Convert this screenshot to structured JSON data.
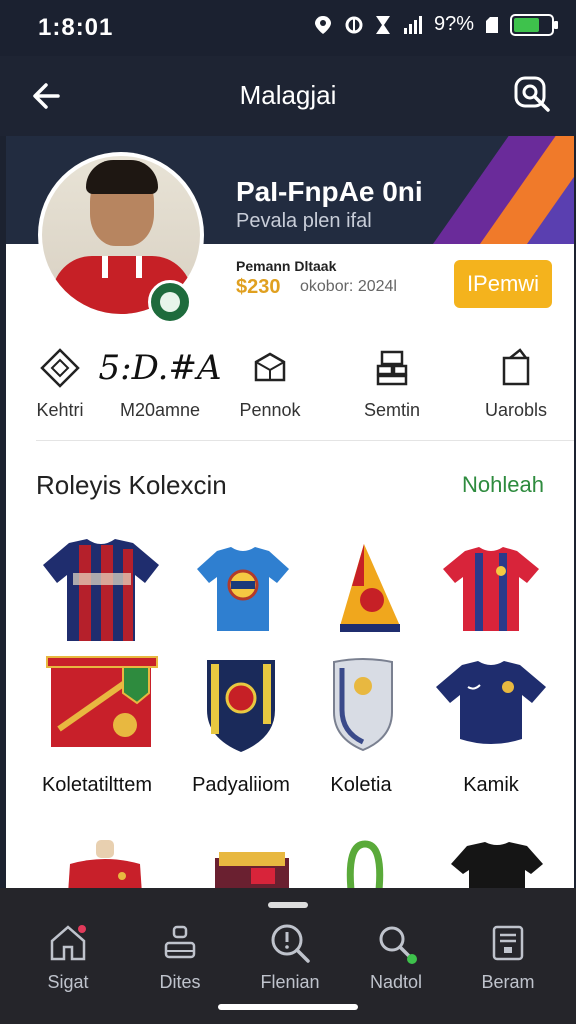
{
  "status_bar": {
    "time": "1:8:01",
    "battery": "9?%"
  },
  "header": {
    "title": "Malagjai",
    "back_icon": "arrow-left-icon",
    "search_icon": "search-icon"
  },
  "profile": {
    "name": "PaI-FnpAe 0ni",
    "subtitle": "Pevala plen ifal",
    "stat_label": "Pemann Dltaak",
    "amount": "$230",
    "date": "okobor: 2024l",
    "follow_label": "IPemwi",
    "accent": "#f4b31d"
  },
  "quick_actions": [
    {
      "label": "Kehtri",
      "icon": "diamond-icon"
    },
    {
      "label": "M20amne",
      "value": "5:D.#A"
    },
    {
      "label": "Pennok",
      "icon": "box-icon"
    },
    {
      "label": "Semtin",
      "icon": "stack-icon"
    },
    {
      "label": "Uarobls",
      "icon": "tag-icon"
    }
  ],
  "collection": {
    "title": "Roleyis Kolexcin",
    "link": "Nohleah",
    "link_color": "#2e8b3e",
    "labels": [
      "Koletatilttem",
      "Padyaliiom",
      "Koletia",
      "Kamik"
    ]
  },
  "bottom_nav": [
    {
      "label": "Sigat",
      "icon": "home-icon"
    },
    {
      "label": "Dites",
      "icon": "user-icon"
    },
    {
      "label": "Flenian",
      "icon": "search-icon"
    },
    {
      "label": "Nadtol",
      "icon": "search-alt-icon"
    },
    {
      "label": "Beram",
      "icon": "document-icon"
    }
  ]
}
